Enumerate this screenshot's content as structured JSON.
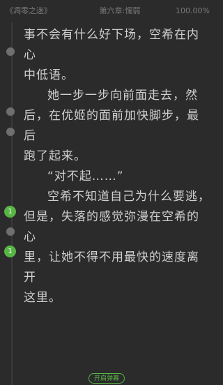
{
  "header": {
    "book_title": "《凋零之迷》",
    "chapter_title": "第六章:懦弱",
    "progress": "100.00%"
  },
  "content": {
    "lines": [
      "事不会有什么好下场，空希在内心",
      "中低语。",
      "她一步一步向前面走去，然",
      "后，在优姬的面前加快脚步，最后",
      "跑了起来。",
      "“对不起……”",
      "空希不知道自己为什么要逃，",
      "但是，失落的感觉弥漫在空希的心",
      "里，让她不得不用最快的速度离开",
      "这里。"
    ]
  },
  "markers": {
    "green_count_1": "1",
    "green_count_2": "1"
  },
  "footer": {
    "danmaku_button": "开启弹幕"
  },
  "colors": {
    "background": "#2b2b2b",
    "accent": "#58b545",
    "marker_gray": "#6f6f6f"
  }
}
